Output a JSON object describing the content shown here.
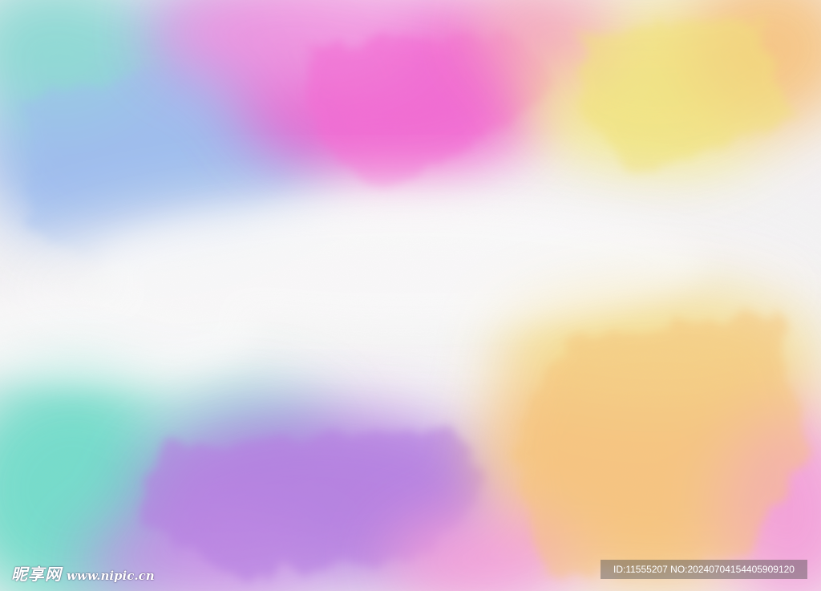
{
  "watermark": {
    "logo_text": "昵享网",
    "url_text": "www.nipic.cn",
    "id_text": "ID:11555207 NO:20240704154405909120"
  },
  "palette": {
    "paper": "#f4f2f4",
    "blue": "#8fb4ec",
    "magenta": "#f15fcf",
    "yellow": "#f4e88a",
    "orange": "#f8c27c",
    "teal": "#5fd9c4",
    "violet": "#b07ae0",
    "pink": "#f49ad8"
  }
}
